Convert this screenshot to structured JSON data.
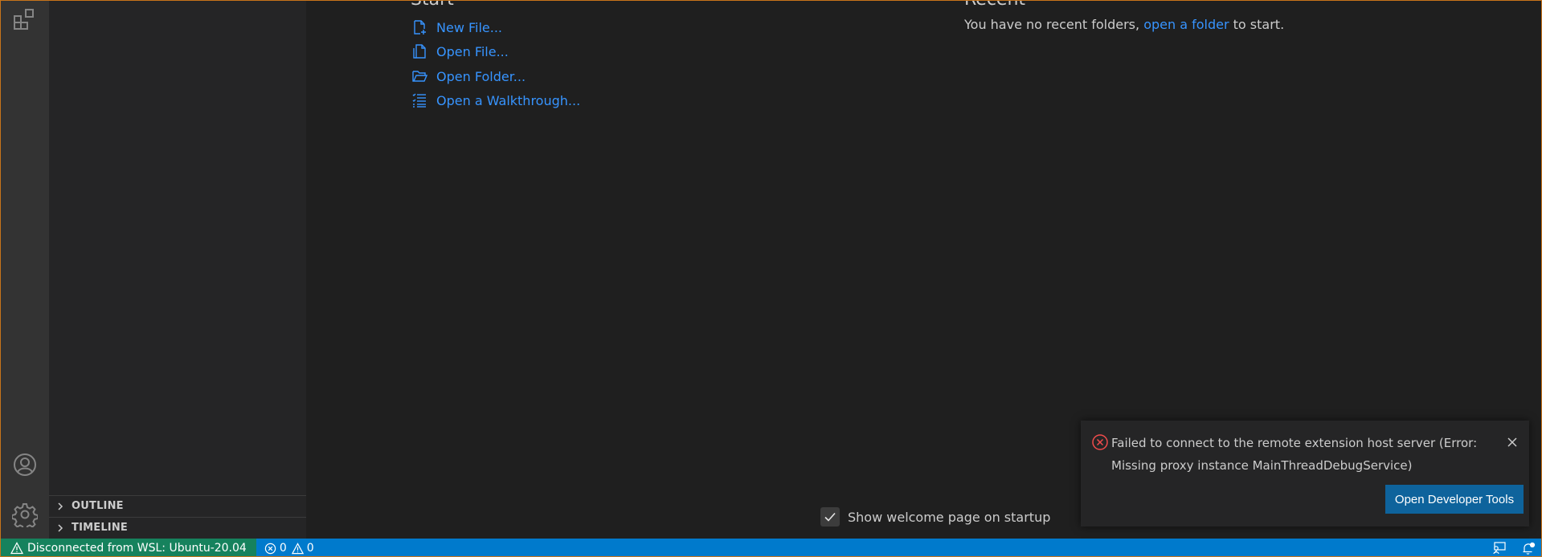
{
  "panels": {
    "outline_label": "OUTLINE",
    "timeline_label": "TIMELINE"
  },
  "welcome": {
    "start_title": "Start",
    "recent_title": "Recent",
    "start_items": [
      {
        "label": "New File...",
        "icon": "new-file-icon"
      },
      {
        "label": "Open File...",
        "icon": "open-file-icon"
      },
      {
        "label": "Open Folder...",
        "icon": "folder-icon"
      },
      {
        "label": "Open a Walkthrough...",
        "icon": "walkthrough-icon"
      }
    ],
    "recent_prefix": "You have no recent folders,",
    "recent_link": "open a folder",
    "recent_suffix": "to start.",
    "show_on_startup_label": "Show welcome page on startup",
    "show_on_startup_checked": true
  },
  "notification": {
    "message": "Failed to connect to the remote extension host server (Error: Missing proxy instance MainThreadDebugService)",
    "button_label": "Open Developer Tools"
  },
  "status_bar": {
    "remote_label": "Disconnected from WSL: Ubuntu-20.04",
    "errors": "0",
    "warnings": "0"
  },
  "colors": {
    "accent": "#007acc",
    "remote_bg": "#16825d",
    "link": "#3794ff",
    "button": "#0e639c",
    "error": "#f14c4c",
    "window_border": "#c8741a"
  }
}
